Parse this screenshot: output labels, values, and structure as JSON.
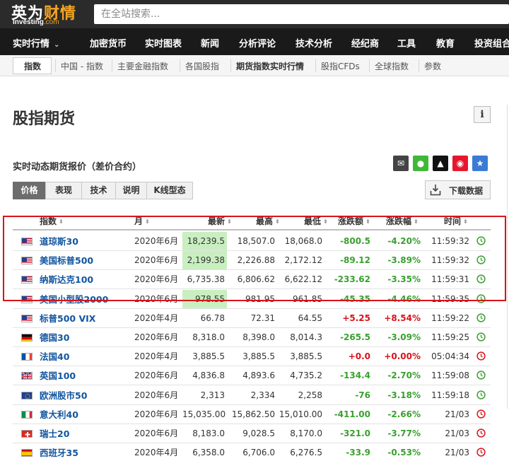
{
  "header": {
    "logo_cn_a": "英为",
    "logo_cn_b": "财情",
    "logo_en": "Investing",
    "logo_en_suffix": ".com",
    "search_placeholder": "在全站搜索..."
  },
  "main_nav": [
    {
      "label": "实时行情",
      "chevron": true
    },
    {
      "label": "加密货币"
    },
    {
      "label": "实时图表"
    },
    {
      "label": "新闻"
    },
    {
      "label": "分析评论"
    },
    {
      "label": "技术分析"
    },
    {
      "label": "经纪商"
    },
    {
      "label": "工具"
    },
    {
      "label": "教育"
    },
    {
      "label": "投资组合"
    }
  ],
  "sub_nav": [
    {
      "label": "指数",
      "active": true
    },
    {
      "label": "中国 - 指数"
    },
    {
      "label": "主要金融指数"
    },
    {
      "label": "各国股指"
    },
    {
      "label": "期货指数实时行情",
      "strong": true
    },
    {
      "label": "股指CFDs"
    },
    {
      "label": "全球指数"
    },
    {
      "label": "参数"
    }
  ],
  "page": {
    "title": "股指期货",
    "info_label": "i",
    "section_title": "实时动态期货报价（差价合约）",
    "download_label": "下载数据"
  },
  "share_icons": [
    {
      "name": "email-icon",
      "color": "#444444",
      "glyph": "✉"
    },
    {
      "name": "wechat-icon",
      "color": "#3fb837",
      "glyph": "●"
    },
    {
      "name": "qq-icon",
      "color": "#111111",
      "glyph": "▲"
    },
    {
      "name": "weibo-icon",
      "color": "#e6162d",
      "glyph": "◉"
    },
    {
      "name": "favorite-icon",
      "color": "#3a7bd5",
      "glyph": "★"
    }
  ],
  "tabs": [
    "价格",
    "表现",
    "技术",
    "说明",
    "K线型态"
  ],
  "table": {
    "columns": [
      "指数",
      "月",
      "最新",
      "最高",
      "最低",
      "涨跌额",
      "涨跌幅",
      "时间"
    ],
    "rows": [
      {
        "name": "道琼斯30",
        "flag": "us",
        "month": "2020年6月",
        "last": "18,239.5",
        "high": "18,507.0",
        "low": "18,068.0",
        "chg": "-800.5",
        "pct": "-4.20%",
        "time": "11:59:32",
        "dir": "down",
        "hl": true
      },
      {
        "name": "美国标普500",
        "flag": "us",
        "month": "2020年6月",
        "last": "2,199.38",
        "high": "2,226.88",
        "low": "2,172.12",
        "chg": "-89.12",
        "pct": "-3.89%",
        "time": "11:59:32",
        "dir": "down",
        "hl": true
      },
      {
        "name": "纳斯达克100",
        "flag": "us",
        "month": "2020年6月",
        "last": "6,735.38",
        "high": "6,806.62",
        "low": "6,622.12",
        "chg": "-233.62",
        "pct": "-3.35%",
        "time": "11:59:31",
        "dir": "down",
        "hl": false
      },
      {
        "name": "美国小型股2000",
        "flag": "us",
        "month": "2020年6月",
        "last": "978.55",
        "high": "981.95",
        "low": "961.85",
        "chg": "-45.35",
        "pct": "-4.46%",
        "time": "11:59:35",
        "dir": "down",
        "hl": true
      },
      {
        "name": "标普500 VIX",
        "flag": "us",
        "month": "2020年4月",
        "last": "66.78",
        "high": "72.31",
        "low": "64.55",
        "chg": "+5.25",
        "pct": "+8.54%",
        "time": "11:59:22",
        "dir": "up",
        "hl": false
      },
      {
        "name": "德国30",
        "flag": "de",
        "month": "2020年6月",
        "last": "8,318.0",
        "high": "8,398.0",
        "low": "8,014.3",
        "chg": "-265.5",
        "pct": "-3.09%",
        "time": "11:59:25",
        "dir": "down",
        "hl": false
      },
      {
        "name": "法国40",
        "flag": "fr",
        "month": "2020年4月",
        "last": "3,885.5",
        "high": "3,885.5",
        "low": "3,885.5",
        "chg": "+0.0",
        "pct": "+0.00%",
        "time": "05:04:34",
        "dir": "up",
        "hl": false
      },
      {
        "name": "英国100",
        "flag": "gb",
        "month": "2020年6月",
        "last": "4,836.8",
        "high": "4,893.6",
        "low": "4,735.2",
        "chg": "-134.4",
        "pct": "-2.70%",
        "time": "11:59:08",
        "dir": "down",
        "hl": false
      },
      {
        "name": "欧洲股市50",
        "flag": "eu",
        "month": "2020年6月",
        "last": "2,313",
        "high": "2,334",
        "low": "2,258",
        "chg": "-76",
        "pct": "-3.18%",
        "time": "11:59:18",
        "dir": "down",
        "hl": false
      },
      {
        "name": "意大利40",
        "flag": "it",
        "month": "2020年6月",
        "last": "15,035.00",
        "high": "15,862.50",
        "low": "15,010.00",
        "chg": "-411.00",
        "pct": "-2.66%",
        "time": "21/03",
        "dir": "down",
        "hl": false
      },
      {
        "name": "瑞士20",
        "flag": "ch",
        "month": "2020年6月",
        "last": "8,183.0",
        "high": "9,028.5",
        "low": "8,170.0",
        "chg": "-321.0",
        "pct": "-3.77%",
        "time": "21/03",
        "dir": "down",
        "hl": false
      },
      {
        "name": "西班牙35",
        "flag": "es",
        "month": "2020年4月",
        "last": "6,358.0",
        "high": "6,706.0",
        "low": "6,276.5",
        "chg": "-33.9",
        "pct": "-0.53%",
        "time": "21/03",
        "dir": "down",
        "hl": false
      }
    ]
  },
  "colors": {
    "up": "#3aa02f",
    "down_red": "#d8141a",
    "highlight": "#c9efc1",
    "clock_live": "#3aa02f",
    "clock_closed": "#d8141a",
    "link": "#1256a0"
  }
}
